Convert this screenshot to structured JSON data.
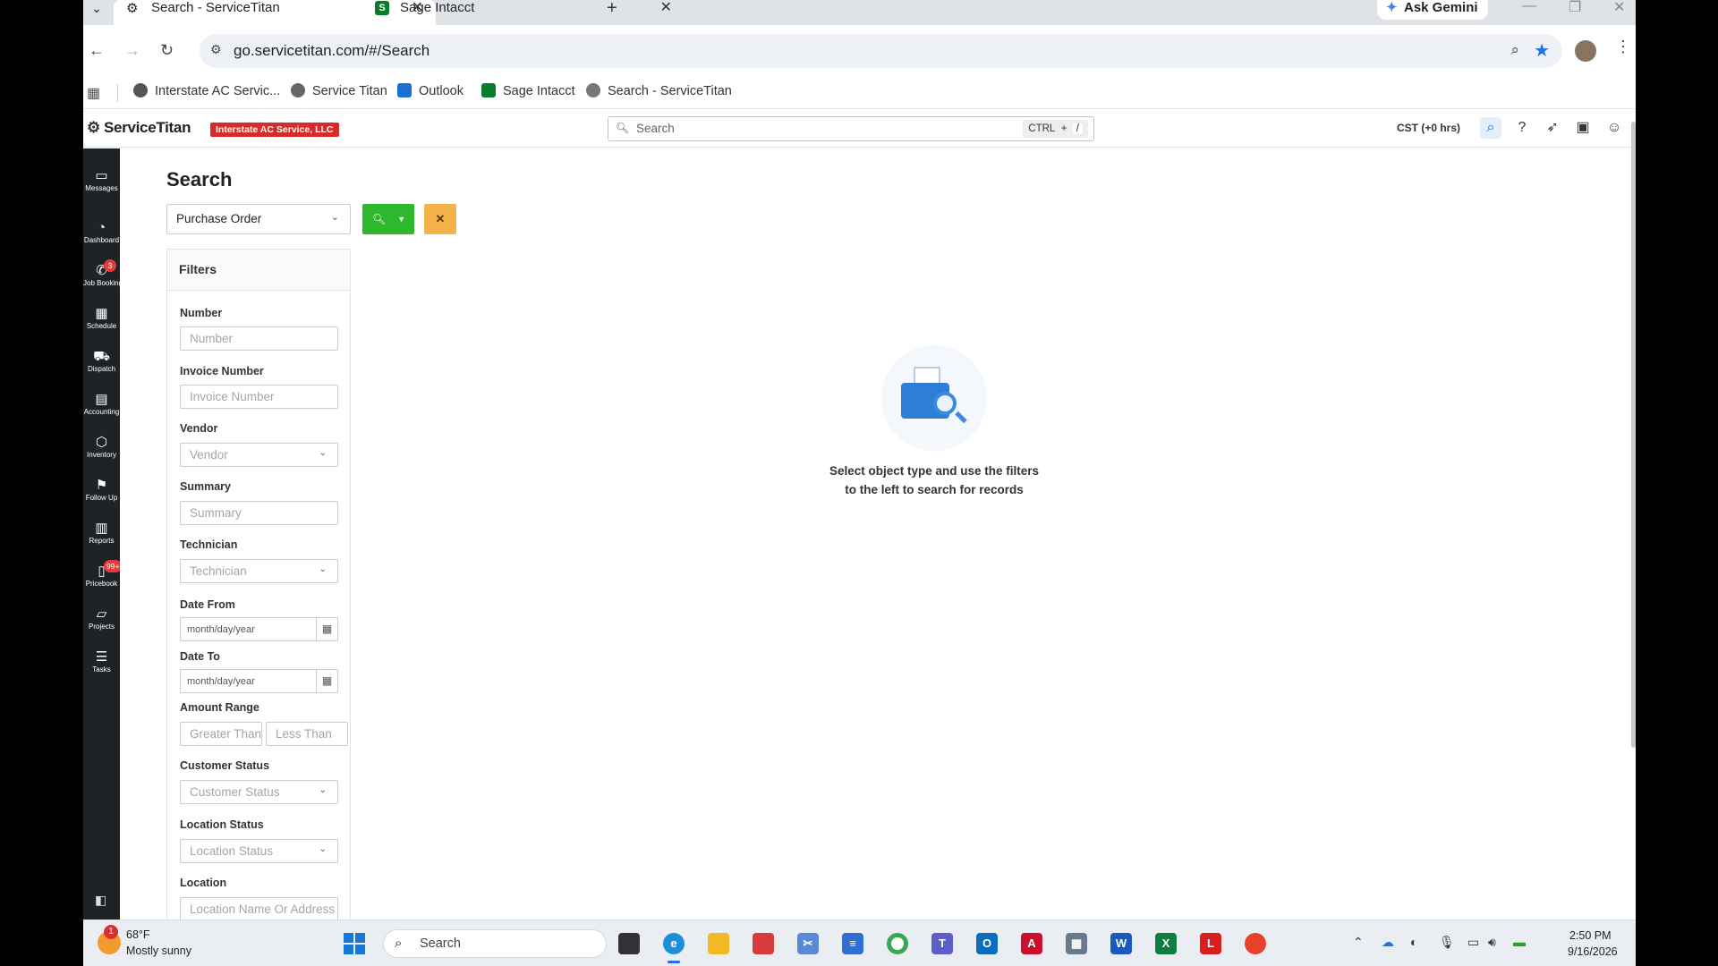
{
  "browser": {
    "tabs": [
      {
        "label": "Search - ServiceTitan",
        "active": true
      },
      {
        "label": "Sage Intacct",
        "active": false
      }
    ],
    "gemini_label": "Ask Gemini",
    "url": "go.servicetitan.com/#/Search",
    "bookmarks": [
      {
        "label": "Interstate AC Servic...",
        "icon": "globe-icon"
      },
      {
        "label": "Service Titan",
        "icon": "servicetitan-icon"
      },
      {
        "label": "Outlook",
        "icon": "outlook-icon"
      },
      {
        "label": "Sage Intacct",
        "icon": "sage-icon"
      },
      {
        "label": "Search - ServiceTitan",
        "icon": "servicetitan-icon"
      }
    ]
  },
  "header": {
    "logo": "ServiceTitan",
    "tenant": "Interstate AC Service, LLC",
    "search_placeholder": "Search",
    "shortcut_key": "CTRL",
    "shortcut_plus": "+",
    "shortcut_slash": "/",
    "timezone": "CST (+0 hrs)"
  },
  "nav": [
    {
      "label": "Messages",
      "icon": "message-icon"
    },
    {
      "label": "Dashboard",
      "icon": "dashboard-icon"
    },
    {
      "label": "Job Booking",
      "icon": "phone-icon",
      "badge": "3"
    },
    {
      "label": "Schedule",
      "icon": "calendar-icon"
    },
    {
      "label": "Dispatch",
      "icon": "truck-icon"
    },
    {
      "label": "Accounting",
      "icon": "accounting-icon"
    },
    {
      "label": "Inventory",
      "icon": "box-icon"
    },
    {
      "label": "Follow Up",
      "icon": "flag-icon"
    },
    {
      "label": "Reports",
      "icon": "chart-icon"
    },
    {
      "label": "Pricebook",
      "icon": "book-icon",
      "badge": "99+"
    },
    {
      "label": "Projects",
      "icon": "folder-icon"
    },
    {
      "label": "Tasks",
      "icon": "tasks-icon"
    }
  ],
  "search": {
    "title": "Search",
    "object_type": "Purchase Order",
    "filters_title": "Filters",
    "fields": {
      "number_label": "Number",
      "number_placeholder": "Number",
      "invoice_label": "Invoice Number",
      "invoice_placeholder": "Invoice Number",
      "vendor_label": "Vendor",
      "vendor_placeholder": "Vendor",
      "summary_label": "Summary",
      "summary_placeholder": "Summary",
      "technician_label": "Technician",
      "technician_placeholder": "Technician",
      "date_from_label": "Date From",
      "date_from_placeholder": "month/day/year",
      "date_to_label": "Date To",
      "date_to_placeholder": "month/day/year",
      "amount_label": "Amount Range",
      "amount_gt_placeholder": "Greater Than",
      "amount_lt_placeholder": "Less Than",
      "customer_status_label": "Customer Status",
      "customer_status_placeholder": "Customer Status",
      "location_status_label": "Location Status",
      "location_status_placeholder": "Location Status",
      "location_label": "Location",
      "location_placeholder": "Location Name Or Address"
    },
    "empty_line1": "Select object type and use the filters",
    "empty_line2": "to the left to search for records"
  },
  "taskbar": {
    "weather_badge": "1",
    "weather_temp": "68°F",
    "weather_desc": "Mostly sunny",
    "search_label": "Search",
    "time": "2:50 PM",
    "date": "9/16/2026"
  },
  "colors": {
    "search_button": "#2eb82e",
    "clear_button": "#f3b24a",
    "tenant_badge": "#d62b2b",
    "nav_background": "#1e2328"
  }
}
